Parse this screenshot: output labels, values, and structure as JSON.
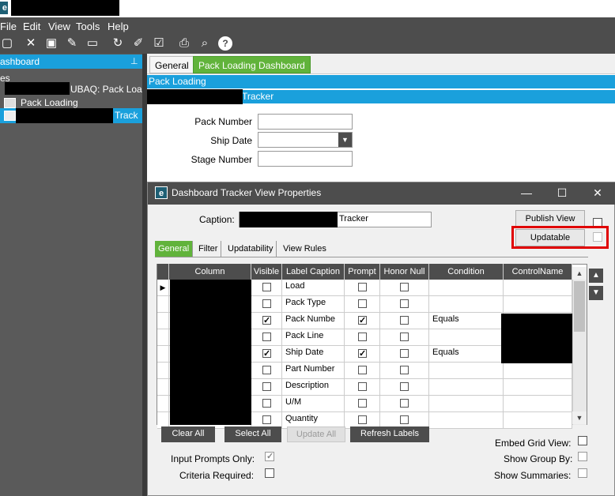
{
  "menu": [
    "File",
    "Edit",
    "View",
    "Tools",
    "Help"
  ],
  "toolbar": {
    "icons": [
      "new-icon",
      "delete-icon",
      "save-icon",
      "clear-icon",
      "notes-icon",
      "refresh-icon",
      "brush-icon",
      "approve-icon",
      "print-icon",
      "print-preview-icon",
      "help-icon"
    ]
  },
  "left_panel": {
    "header": "ashboard",
    "pin": "⊥",
    "items": [
      "es",
      "UBAQ: Pack Loa",
      "Pack Loading",
      "Track"
    ]
  },
  "tabs": [
    "General",
    "Pack Loading Dashboard"
  ],
  "bars": {
    "pack_loading": "Pack Loading",
    "tracker": "Tracker"
  },
  "form": {
    "pack_number": "Pack Number",
    "ship_date": "Ship Date",
    "stage_number": "Stage Number"
  },
  "dialog": {
    "title": "Dashboard Tracker View Properties",
    "caption_label": "Caption:",
    "caption_value": "Tracker",
    "publish_view": "Publish View",
    "updatable": "Updatable",
    "subtabs": [
      "General",
      "Filter",
      "Updatability",
      "View Rules"
    ],
    "columns": [
      "Column",
      "Visible",
      "Label Caption",
      "Prompt",
      "Honor Null",
      "Condition",
      "ControlName"
    ],
    "rows": [
      {
        "label": "Load",
        "visible": false,
        "prompt": false,
        "honor": false,
        "condition": ""
      },
      {
        "label": "Pack Type",
        "visible": false,
        "prompt": false,
        "honor": false,
        "condition": ""
      },
      {
        "label": "Pack Numbe",
        "visible": true,
        "prompt": true,
        "honor": false,
        "condition": "Equals"
      },
      {
        "label": "Pack Line",
        "visible": false,
        "prompt": false,
        "honor": false,
        "condition": ""
      },
      {
        "label": "Ship Date",
        "visible": true,
        "prompt": true,
        "honor": false,
        "condition": "Equals"
      },
      {
        "label": "Part Number",
        "visible": false,
        "prompt": false,
        "honor": false,
        "condition": ""
      },
      {
        "label": "Description",
        "visible": false,
        "prompt": false,
        "honor": false,
        "condition": ""
      },
      {
        "label": "U/M",
        "visible": false,
        "prompt": false,
        "honor": false,
        "condition": ""
      },
      {
        "label": "Quantity",
        "visible": false,
        "prompt": false,
        "honor": false,
        "condition": ""
      }
    ],
    "buttons": {
      "clear_all": "Clear All",
      "select_all": "Select All",
      "update_all": "Update All",
      "refresh_labels": "Refresh Labels"
    },
    "input_prompts_only": "Input Prompts Only:",
    "criteria_required": "Criteria Required:",
    "embed_grid_view": "Embed Grid View:",
    "show_group_by": "Show Group By:",
    "show_summaries": "Show Summaries:"
  },
  "colors": {
    "accent_blue": "#1aa0dc",
    "accent_green": "#61b33b",
    "dark": "#4d4d4d",
    "highlight_red": "#e00000"
  }
}
